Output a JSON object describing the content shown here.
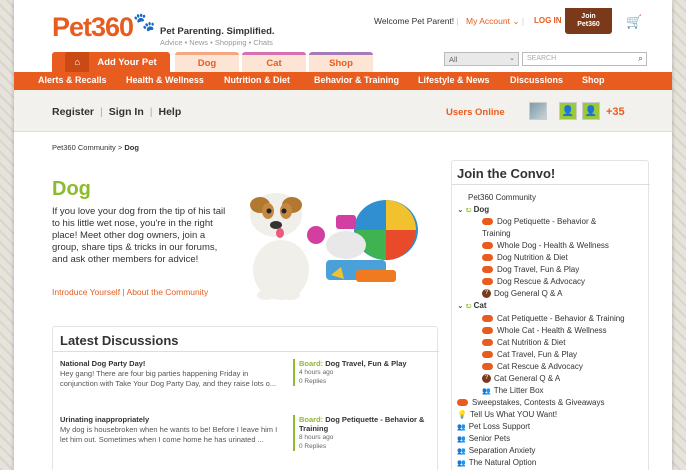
{
  "header": {
    "logo": "Pet360",
    "tagline": "Pet Parenting. Simplified.",
    "subtagline": "Advice • News • Shopping • Chats",
    "welcome": "Welcome Pet Parent!",
    "my_account": "My Account",
    "login": "LOG IN",
    "join_line1": "Join",
    "join_line2": "Pet360",
    "search_placeholder": "SEARCH",
    "search_scope": "All"
  },
  "tabs": [
    "Add Your Pet",
    "Dog",
    "Cat",
    "Shop"
  ],
  "nav": [
    "Alerts & Recalls",
    "Health & Wellness",
    "Nutrition & Diet",
    "Behavior & Training",
    "Lifestyle & News",
    "Discussions",
    "Shop"
  ],
  "subbar": {
    "register": "Register",
    "sign_in": "Sign In",
    "help": "Help",
    "users_online": "Users Online",
    "plus_count": "+35"
  },
  "breadcrumb": {
    "root": "Pet360 Community",
    "current": "Dog"
  },
  "main": {
    "title": "Dog",
    "intro": "If you love your dog from the tip of his tail to his little wet nose, you're in the right place! Meet other dog owners, join a group, share tips & tricks in our forums, and ask other members for advice!",
    "intro_link1": "Introduce Yourself",
    "intro_link2": "About the Community"
  },
  "latest": {
    "title": "Latest Discussions",
    "items": [
      {
        "title": "National Dog Party Day!",
        "body": "Hey gang! There are four big parties happening Friday in conjunction with Take Your Dog Party Day, and they raise lots o...",
        "board_label": "Board:",
        "board": "Dog Travel, Fun & Play",
        "time": "4 hours ago",
        "replies": "0 Replies"
      },
      {
        "title": "Urinating inappropriately",
        "body": "My dog is housebroken when he wants to be! Before I leave him I let him out. Sometimes when I come home he has urinated ...",
        "board_label": "Board:",
        "board": "Dog Petiquette - Behavior & Training",
        "time": "8 hours ago",
        "replies": "0 Replies"
      }
    ]
  },
  "convo": {
    "title": "Join the Convo!",
    "root": "Pet360 Community",
    "dog": "Dog",
    "dog_items": [
      "Dog Petiquette - Behavior &",
      "Training",
      "Whole Dog - Health & Wellness",
      "Dog Nutrition & Diet",
      "Dog Travel, Fun & Play",
      "Dog Rescue & Advocacy",
      "Dog General Q & A"
    ],
    "cat": "Cat",
    "cat_items": [
      "Cat Petiquette - Behavior & Training",
      "Whole Cat - Health & Wellness",
      "Cat Nutrition & Diet",
      "Cat Travel, Fun & Play",
      "Cat Rescue & Advocacy",
      "Cat General Q & A",
      "The Litter Box"
    ],
    "other_items": [
      "Sweepstakes, Contests & Giveaways",
      "Tell Us What YOU Want!",
      "Pet Loss Support",
      "Senior Pets",
      "Separation Anxiety",
      "The Natural Option"
    ]
  }
}
